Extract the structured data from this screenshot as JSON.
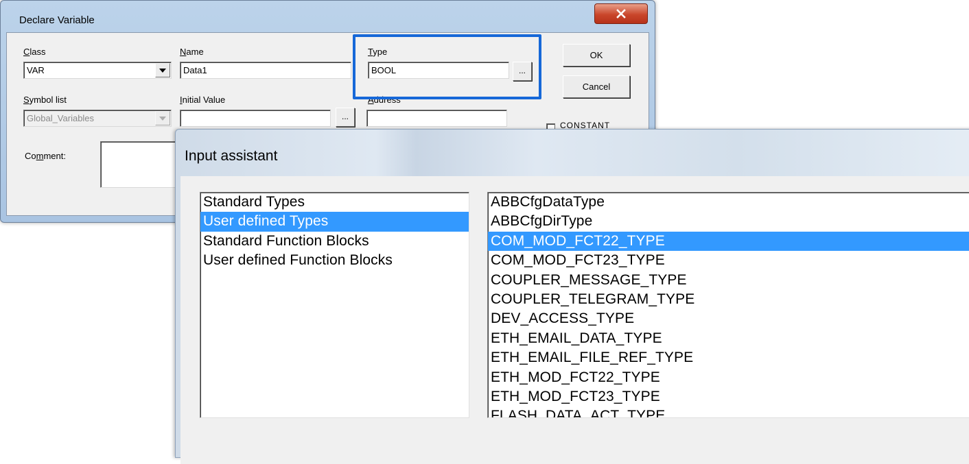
{
  "declare_variable": {
    "title": "Declare Variable",
    "class": {
      "label_u": "C",
      "label_rest": "lass",
      "value": "VAR"
    },
    "name": {
      "label_u": "N",
      "label_rest": "ame",
      "value": "Data1"
    },
    "type": {
      "label_u": "T",
      "label_rest": "ype",
      "value": "BOOL",
      "browse_label": "..."
    },
    "symbol_list": {
      "label_u": "S",
      "label_rest": "ymbol list",
      "value": "Global_Variables"
    },
    "initial_value": {
      "label_u": "I",
      "label_rest": "nitial Value",
      "value": "",
      "browse_label": "..."
    },
    "address": {
      "label_u": "A",
      "label_rest": "ddress",
      "value": ""
    },
    "comment": {
      "label_pre": "Co",
      "label_u": "m",
      "label_rest": "ment:",
      "value": ""
    },
    "ok_label": "OK",
    "cancel_label": "Cancel",
    "constant_label": "CONSTANT",
    "highlight_color": "#1668d8"
  },
  "input_assistant": {
    "title": "Input assistant",
    "categories": [
      {
        "label": "Standard Types",
        "selected": false
      },
      {
        "label": "User defined Types",
        "selected": true
      },
      {
        "label": "Standard Function Blocks",
        "selected": false
      },
      {
        "label": "User defined Function Blocks",
        "selected": false
      }
    ],
    "types": [
      {
        "label": "ABBCfgDataType",
        "selected": false
      },
      {
        "label": "ABBCfgDirType",
        "selected": false
      },
      {
        "label": "COM_MOD_FCT22_TYPE",
        "selected": true
      },
      {
        "label": "COM_MOD_FCT23_TYPE",
        "selected": false
      },
      {
        "label": "COUPLER_MESSAGE_TYPE",
        "selected": false
      },
      {
        "label": "COUPLER_TELEGRAM_TYPE",
        "selected": false
      },
      {
        "label": "DEV_ACCESS_TYPE",
        "selected": false
      },
      {
        "label": "ETH_EMAIL_DATA_TYPE",
        "selected": false
      },
      {
        "label": "ETH_EMAIL_FILE_REF_TYPE",
        "selected": false
      },
      {
        "label": "ETH_MOD_FCT22_TYPE",
        "selected": false
      },
      {
        "label": "ETH_MOD_FCT23_TYPE",
        "selected": false
      },
      {
        "label": "FLASH_DATA_ACT_TYPE",
        "selected": false
      }
    ],
    "selection_color": "#3399ff"
  }
}
